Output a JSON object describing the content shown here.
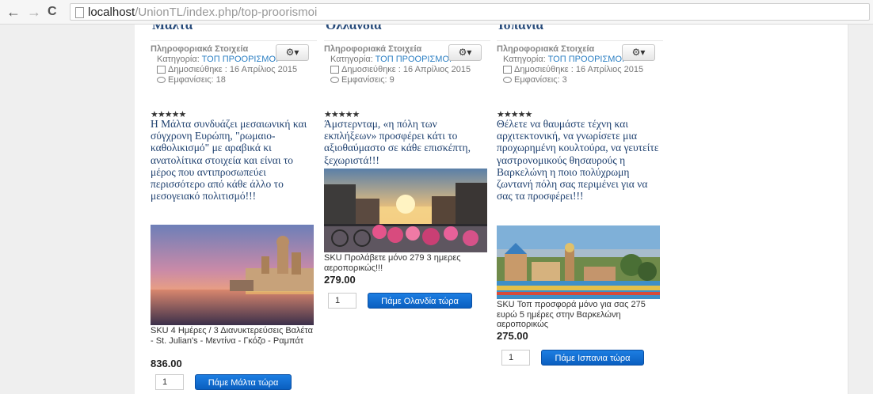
{
  "browser": {
    "back_icon": "←",
    "forward_icon": "→",
    "reload_icon": "C",
    "url_host": "localhost",
    "url_path": "/UnionTL/index.php/top-proorismoi"
  },
  "articles": [
    {
      "info_heading": "Πληροφοριακά Στοιχεία",
      "category_label": "Κατηγορία:",
      "category_link": "ΤΟΠ ΠΡΟΟΡΙΣΜΟΙ",
      "published": "Δημοσιεύθηκε : 16 Απρίλιος 2015",
      "hits": "Εμφανίσεις: 18",
      "gear": "⚙▾",
      "rating": "★★★★★",
      "intro": "Η Μάλτα συνδυάζει μεσαιωνική και σύγχρονη Ευρώπη, \"ρωμαιο-καθολικισμό\" με αραβικά κι ανατολίτικα στοιχεία και είναι το μέρος που αντιπροσωπεύει περισσότερο από κάθε άλλο το μεσογειακό πολιτισμό!!!",
      "sku": "SKU 4 Ημέρες / 3 Διανυκτερεύσεις Βαλέτα - St. Julian's - Μεντίνα - Γκόζο - Ραμπάτ",
      "price": "836.00",
      "qty": "1",
      "button": "Πάμε Μάλτα τώρα"
    },
    {
      "info_heading": "Πληροφοριακά Στοιχεία",
      "category_label": "Κατηγορία:",
      "category_link": "ΤΟΠ ΠΡΟΟΡΙΣΜΟΙ",
      "published": "Δημοσιεύθηκε : 16 Απρίλιος 2015",
      "hits": "Εμφανίσεις: 9",
      "gear": "⚙▾",
      "rating": "★★★★★",
      "intro": "Άμστερνταμ, «η πόλη των εκπλήξεων» προσφέρει κάτι το αξιοθαύμαστο σε κάθε επισκέπτη, ξεχωριστά!!!",
      "sku": "SKU Προλάβετε μόνο 279 3 ημερες αεροπορικώς!!!",
      "price": "279.00",
      "qty": "1",
      "button": "Πάμε Ολανδία τώρα"
    },
    {
      "info_heading": "Πληροφοριακά Στοιχεία",
      "category_label": "Κατηγορία:",
      "category_link": "ΤΟΠ ΠΡΟΟΡΙΣΜΟΙ",
      "published": "Δημοσιεύθηκε : 16 Απρίλιος 2015",
      "hits": "Εμφανίσεις: 3",
      "gear": "⚙▾",
      "rating": "★★★★★",
      "intro": "Θέλετε να θαυμάστε τέχνη και αρχιτεκτονική, να γνωρίσετε μια προχωρημένη κουλτούρα, να γευτείτε γαστρονομικούς θησαυρούς η Βαρκελώνη η ποιο πολύχρωμη ζωντανή πόλη σας περιμένει για να σας τα προσφέρει!!!",
      "sku": "SKU Τοπ προσφορά μόνο για σας 275 ευρώ 5 ημέρες στην Βαρκελώνη αεροπορικώς",
      "price": "275.00",
      "qty": "1",
      "button": "Πάμε Ισπανια τώρα"
    }
  ]
}
